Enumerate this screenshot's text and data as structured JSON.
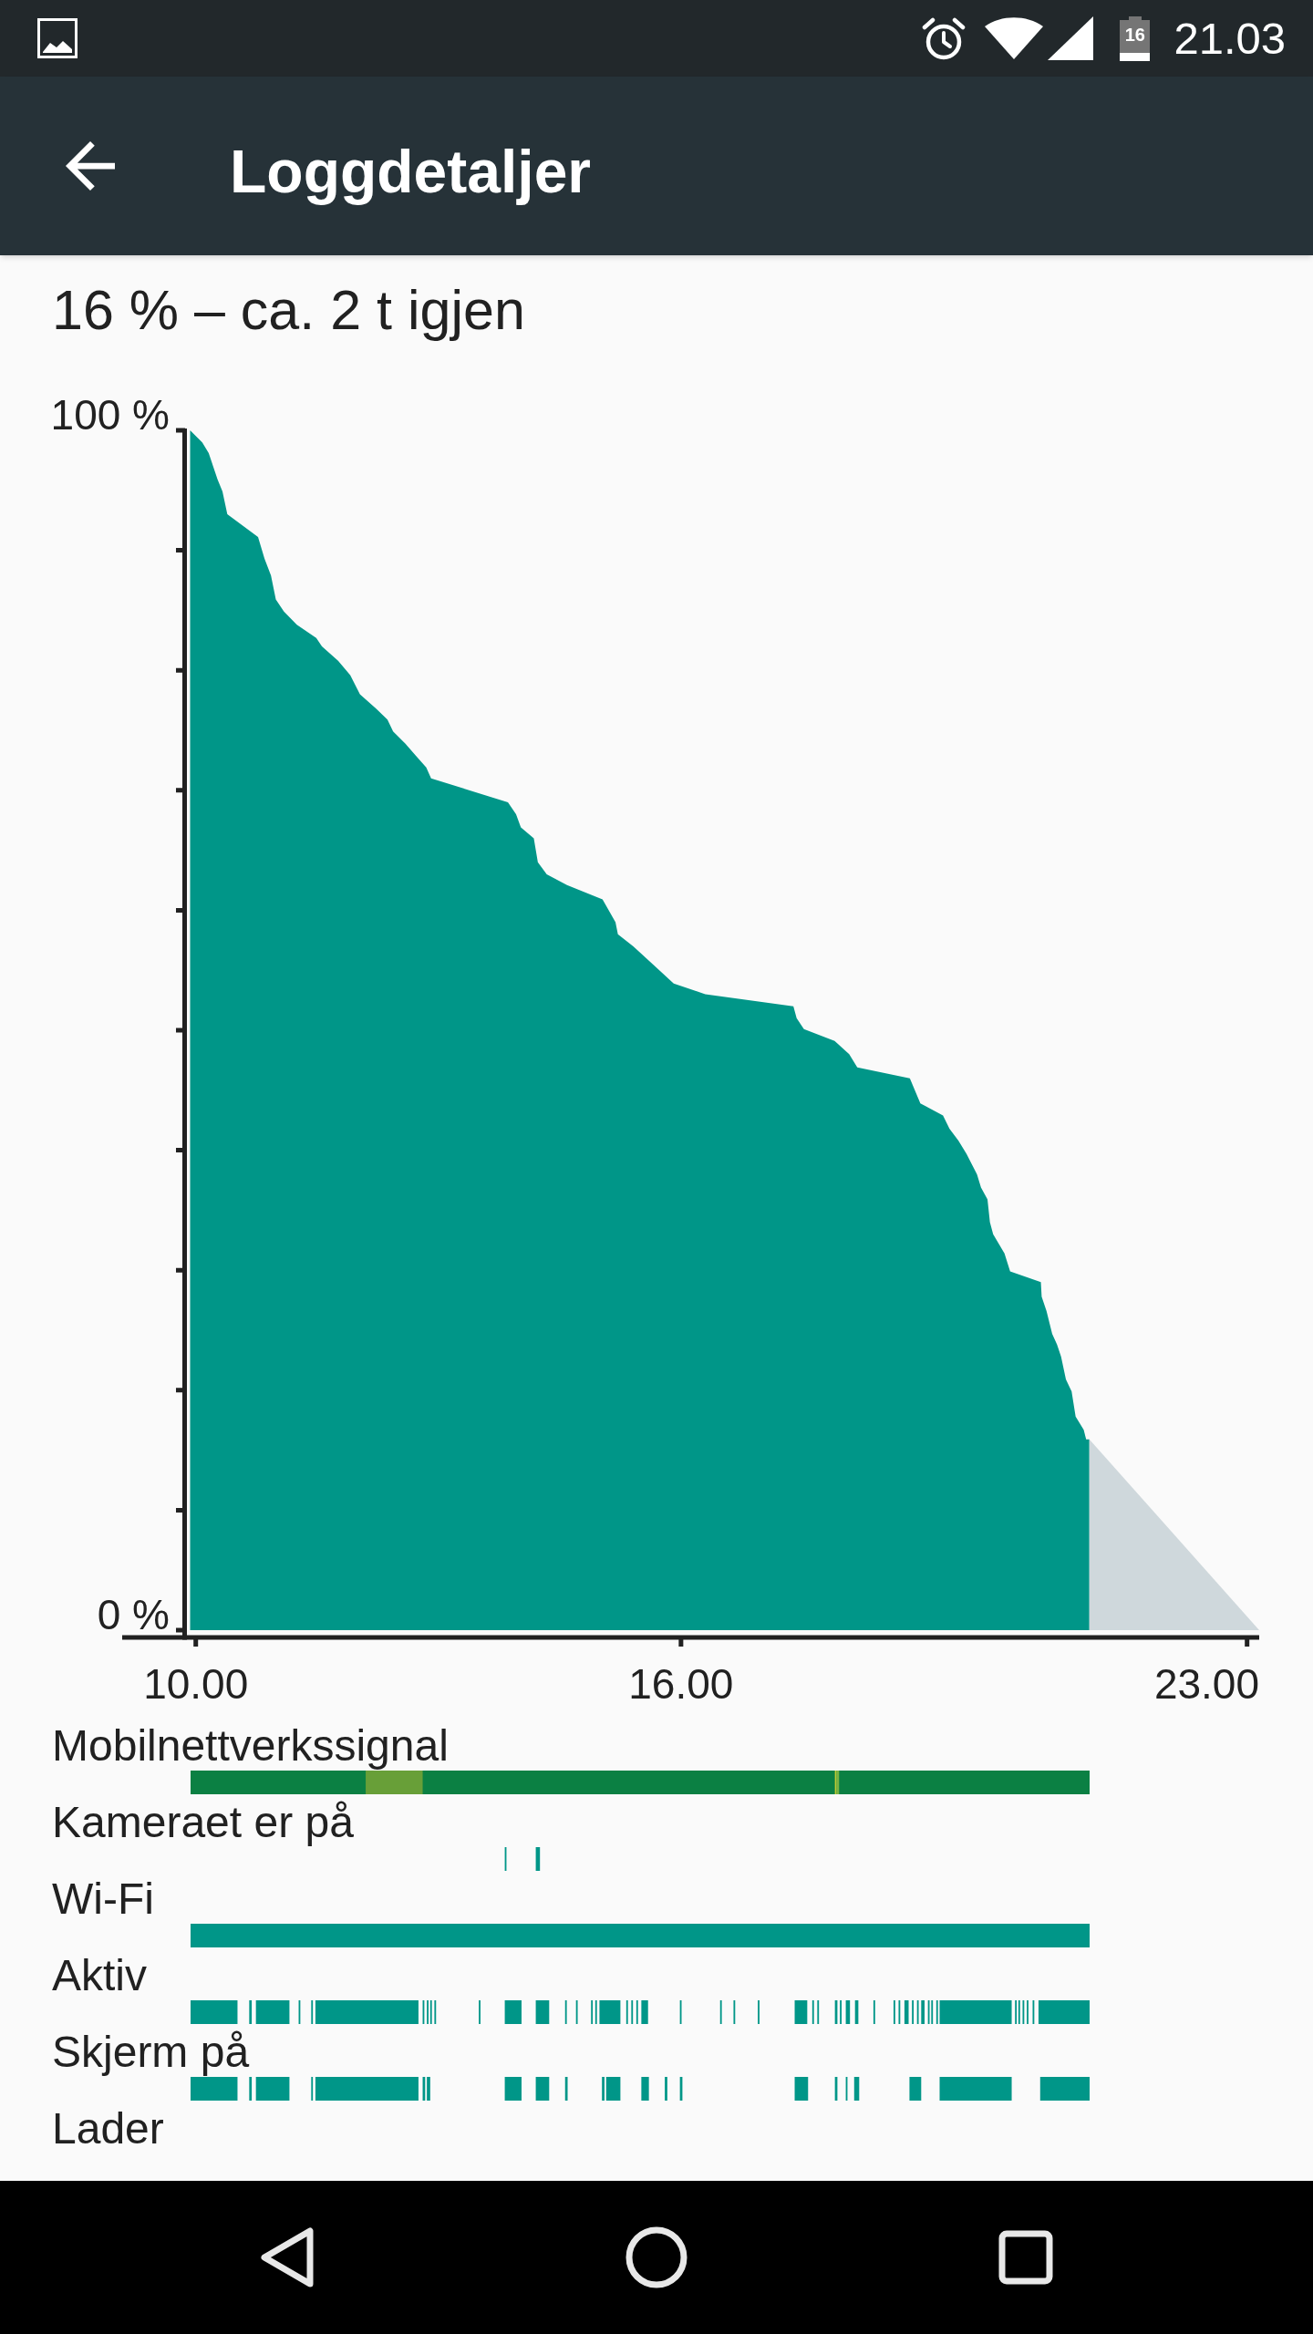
{
  "status_bar": {
    "battery_text": "16",
    "time": "21.03"
  },
  "app_bar": {
    "title": "Loggdetaljer"
  },
  "summary": "16 % – ca. 2 t igjen",
  "chart": {
    "chart_data": {
      "type": "area",
      "x": [
        9.93,
        10.08,
        10.16,
        10.21,
        10.27,
        10.33,
        10.39,
        10.77,
        10.85,
        10.93,
        10.99,
        11.09,
        11.25,
        11.49,
        11.56,
        11.76,
        11.91,
        12.03,
        12.23,
        12.37,
        12.44,
        12.59,
        12.72,
        12.85,
        12.91,
        13.86,
        13.96,
        14.02,
        14.18,
        14.23,
        14.34,
        14.59,
        15.03,
        15.19,
        15.22,
        15.41,
        15.65,
        15.91,
        16.3,
        17.39,
        17.43,
        17.52,
        17.9,
        18.08,
        18.18,
        18.83,
        18.96,
        19.24,
        19.32,
        19.43,
        19.53,
        19.66,
        19.71,
        19.79,
        19.82,
        19.86,
        20.0,
        20.07,
        20.45,
        20.46,
        20.52,
        20.59,
        20.65,
        20.7,
        20.76,
        20.83,
        20.88,
        20.98,
        21.01,
        21.05,
        23.15
      ],
      "series": [
        {
          "color": "#009688",
          "values": [
            100,
            99.0,
            98.1,
            97.1,
            95.9,
            94.9,
            93.0,
            91.1,
            89.3,
            87.9,
            85.9,
            84.9,
            83.8,
            82.7,
            82.0,
            80.8,
            79.6,
            78.0,
            76.8,
            75.9,
            74.9,
            73.9,
            72.9,
            71.9,
            71.0,
            69.0,
            68.0,
            66.9,
            66.0,
            64.0,
            63.0,
            62.1,
            60.9,
            59.0,
            58.0,
            57.0,
            55.5,
            53.9,
            53.0,
            52.0,
            51.0,
            50.1,
            49.1,
            48.0,
            46.9,
            46.0,
            43.9,
            42.9,
            41.8,
            40.8,
            39.7,
            38.0,
            36.9,
            35.9,
            34.0,
            33.0,
            31.4,
            29.9,
            29.0,
            27.8,
            26.6,
            24.7,
            23.8,
            22.8,
            20.9,
            19.9,
            17.8,
            16.7,
            15.9,
            15.9,
            null
          ]
        },
        {
          "color": "#cfd8dc",
          "values": [
            null,
            null,
            null,
            null,
            null,
            null,
            null,
            null,
            null,
            null,
            null,
            null,
            null,
            null,
            null,
            null,
            null,
            null,
            null,
            null,
            null,
            null,
            null,
            null,
            null,
            null,
            null,
            null,
            null,
            null,
            null,
            null,
            null,
            null,
            null,
            null,
            null,
            null,
            null,
            null,
            null,
            null,
            null,
            null,
            null,
            null,
            null,
            null,
            null,
            null,
            null,
            null,
            null,
            null,
            null,
            null,
            null,
            null,
            null,
            null,
            null,
            null,
            null,
            null,
            null,
            null,
            null,
            null,
            null,
            15.9,
            0
          ]
        }
      ],
      "xlim": [
        9.09,
        23.15
      ],
      "ylim": [
        0,
        100
      ],
      "xticks": [
        {
          "value": 10,
          "label": "10.00"
        },
        {
          "value": 16,
          "label": "16.00"
        },
        {
          "value": 23,
          "label": "23.00"
        }
      ],
      "yticks": [
        {
          "value": 0,
          "label": "0 %"
        },
        {
          "value": 100,
          "label": "100 %"
        }
      ]
    }
  },
  "timelines": [
    {
      "label": "Mobilnettverkssignal",
      "kind": "signal"
    },
    {
      "label": "Kameraet er på",
      "kind": "camera"
    },
    {
      "label": "Wi-Fi",
      "kind": "wifi"
    },
    {
      "label": "Aktiv",
      "kind": "active"
    },
    {
      "label": "Skjerm på",
      "kind": "screen"
    },
    {
      "label": "Lader",
      "kind": "charging"
    }
  ]
}
